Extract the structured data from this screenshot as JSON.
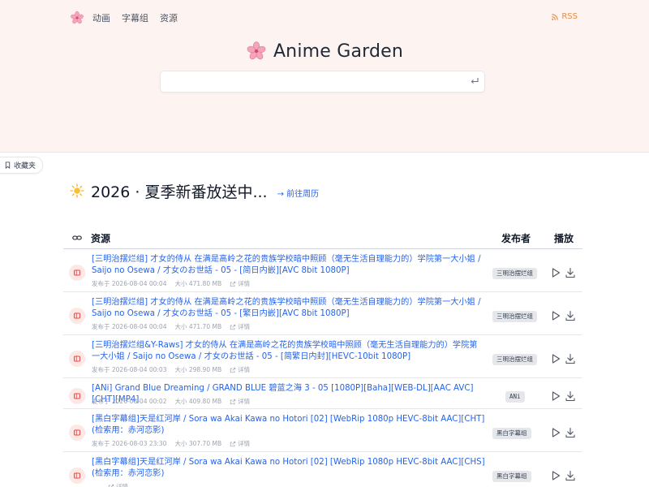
{
  "nav": {
    "links": [
      "动画",
      "字幕组",
      "资源"
    ],
    "rss": "RSS"
  },
  "brand": {
    "title": "Anime Garden"
  },
  "search": {
    "value": "",
    "placeholder": ""
  },
  "bookmark": {
    "label": "收藏夹"
  },
  "season": {
    "title": "2026 · 夏季新番放送中...",
    "link": "→ 前往周历"
  },
  "table": {
    "headers": {
      "resource": "资源",
      "publisher": "发布者",
      "play": "播放"
    },
    "rows": [
      {
        "title": "[三明治摆烂组] 才女的侍从 在满是高岭之花的贵族学校暗中照顾（毫无生活自理能力的）学院第一大小姐 / Saijo no Osewa / 才女のお世話 - 05 - [简日内嵌][AVC 8bit 1080P]",
        "time": "发布于 2026-08-04 00:04",
        "size": "大小 471.80 MB",
        "detail": "详情",
        "publisher": "三明治摆烂组"
      },
      {
        "title": "[三明治摆烂组] 才女的侍从 在满是高岭之花的贵族学校暗中照顾（毫无生活自理能力的）学院第一大小姐 / Saijo no Osewa / 才女のお世話 - 05 - [繁日内嵌][AVC 8bit 1080P]",
        "time": "发布于 2026-08-04 00:04",
        "size": "大小 471.70 MB",
        "detail": "详情",
        "publisher": "三明治摆烂组"
      },
      {
        "title": "[三明治摆烂组&Y-Raws] 才女的侍从 在满是高岭之花的贵族学校暗中照顾（毫无生活自理能力的）学院第一大小姐 / Saijo no Osewa / 才女のお世話 - 05 - [简繁日内封][HEVC-10bit 1080P]",
        "time": "发布于 2026-08-04 00:03",
        "size": "大小 298.90 MB",
        "detail": "详情",
        "publisher": "三明治摆烂组"
      },
      {
        "title": "[ANi] Grand Blue Dreaming / GRAND BLUE 碧蓝之海 3 - 05 [1080P][Baha][WEB-DL][AAC AVC][CHT][MP4]",
        "time": "发布于 2026-08-04 00:02",
        "size": "大小 409.80 MB",
        "detail": "详情",
        "publisher": "ANi"
      },
      {
        "title": "[黑白字幕组]天是红河岸 / Sora wa Akai Kawa no Hotori [02] [WebRip 1080p HEVC-8bit AAC][CHT](检索用：赤河恋影)",
        "time": "发布于 2026-08-03 23:30",
        "size": "大小 307.70 MB",
        "detail": "详情",
        "publisher": "黑白字幕组"
      },
      {
        "title": "[黑白字幕组]天是红河岸 / Sora wa Akai Kawa no Hotori [02] [WebRip 1080p HEVC-8bit AAC][CHS](检索用：赤河恋影)",
        "time": "",
        "size": "",
        "detail": "详情",
        "publisher": "黑白字幕组"
      }
    ]
  },
  "colors": {
    "hero_bg": "#fdf3f1",
    "link": "#2563eb",
    "rss": "#ea8a3e",
    "accent_pink": "#f472b6"
  }
}
